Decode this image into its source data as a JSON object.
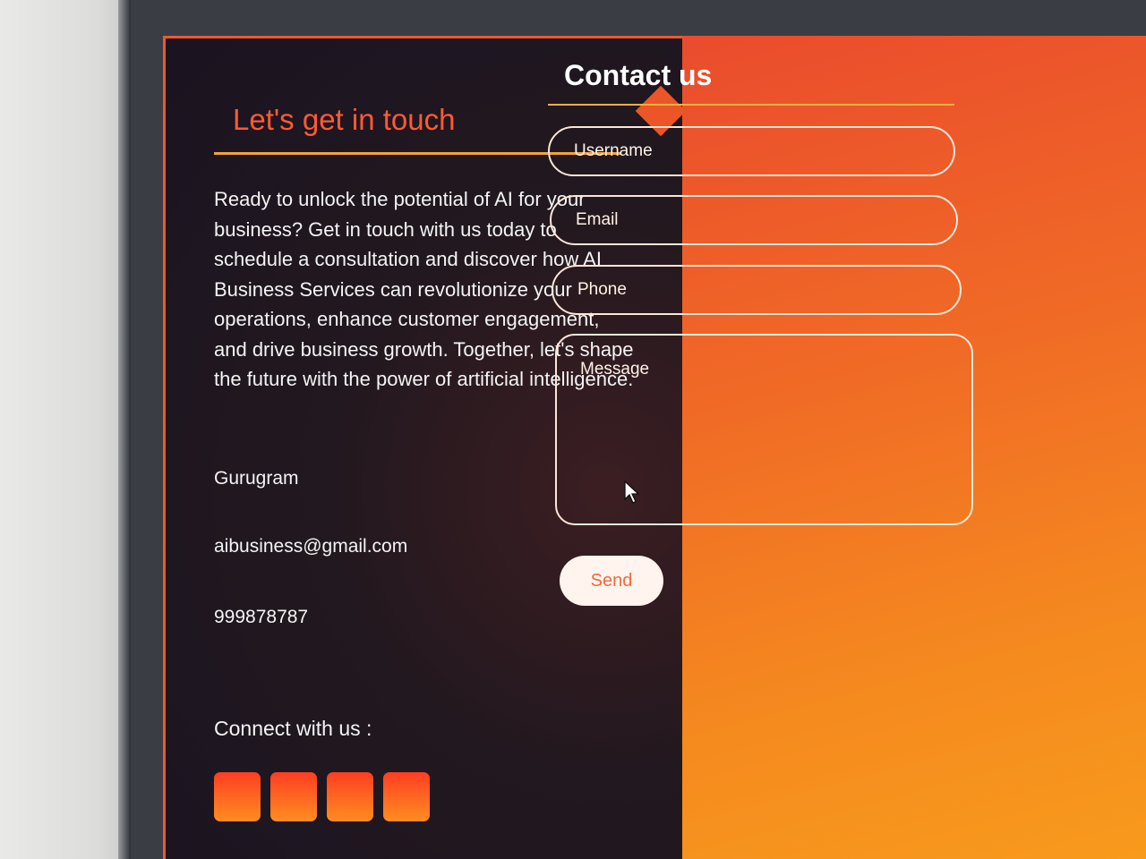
{
  "left": {
    "title": "Let's get in touch",
    "description": "Ready to unlock the potential of AI for your business? Get in touch with us today to schedule a consultation and discover how AI Business Services can revolutionize your operations, enhance customer engagement, and drive business growth. Together, let's shape the future with the power of artificial intelligence.",
    "location": "Gurugram",
    "email": "aibusiness@gmail.com",
    "phone": "999878787",
    "connect_label": "Connect with us :",
    "social_buttons": [
      "social-button",
      "social-button",
      "social-button",
      "social-button"
    ]
  },
  "form": {
    "title": "Contact us",
    "username_placeholder": "Username",
    "email_placeholder": "Email",
    "phone_placeholder": "Phone",
    "message_placeholder": "Message",
    "send_label": "Send"
  },
  "colors": {
    "accent": "#ff5a35",
    "panel_dark": "#1a1420",
    "panel_orange": "#f06a26",
    "divider": "#f5a23c"
  }
}
